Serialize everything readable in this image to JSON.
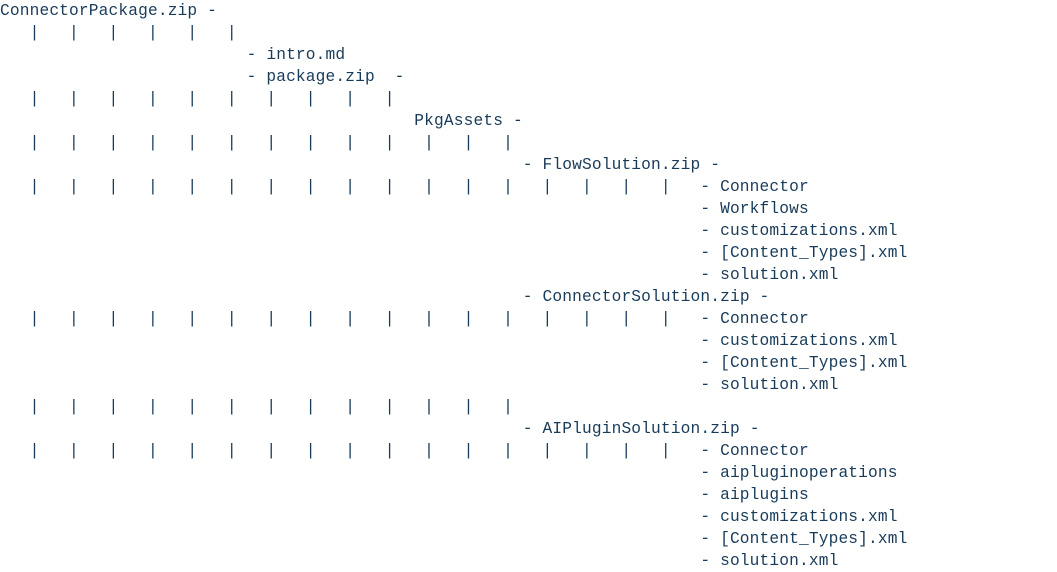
{
  "root": "ConnectorPackage.zip",
  "children": {
    "intro": "intro.md",
    "packageZip": "package.zip",
    "pkgAssets": "PkgAssets",
    "flowSolution": {
      "name": "FlowSolution.zip",
      "items": [
        "Connector",
        "Workflows",
        "customizations.xml",
        "[Content_Types].xml",
        "solution.xml"
      ]
    },
    "connectorSolution": {
      "name": "ConnectorSolution.zip",
      "items": [
        "Connector",
        "customizations.xml",
        "[Content_Types].xml",
        "solution.xml"
      ]
    },
    "aiPluginSolution": {
      "name": "AIPluginSolution.zip",
      "items": [
        "Connector",
        "aipluginoperations",
        "aiplugins",
        "customizations.xml",
        "[Content_Types].xml",
        "solution.xml"
      ]
    }
  }
}
